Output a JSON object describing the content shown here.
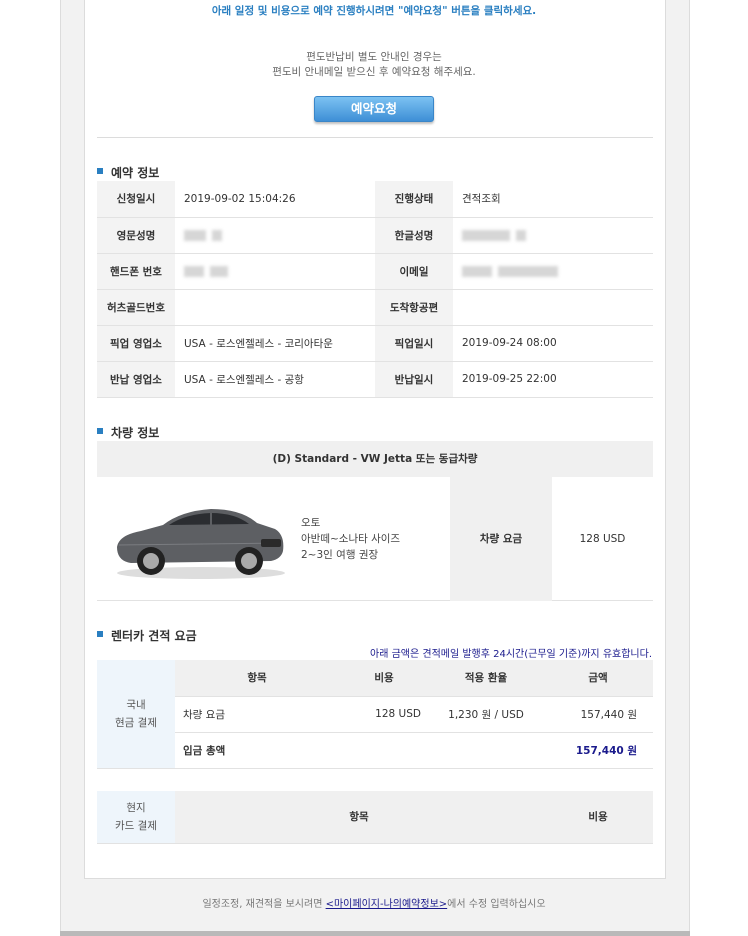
{
  "notice": {
    "top": "아래 일정 및 비용으로 예약 진행하시려면 \"예약요청\" 버튼을 클릭하세요.",
    "sub_line1": "편도반납비 별도 안내인 경우는",
    "sub_line2": "편도비 안내메일 받으신 후 예약요청 해주세요.",
    "reserve_button": "예약요청"
  },
  "reservation": {
    "title": "예약 정보",
    "rows": [
      {
        "l1": "신청일시",
        "v1": "2019-09-02 15:04:26",
        "l2": "진행상태",
        "v2": "견적조회"
      },
      {
        "l1": "영문성명",
        "v1": "",
        "l2": "한글성명",
        "v2": ""
      },
      {
        "l1": "핸드폰 번호",
        "v1": "",
        "l2": "이메일",
        "v2": ""
      },
      {
        "l1": "허츠골드번호",
        "v1": "",
        "l2": "도착항공편",
        "v2": ""
      },
      {
        "l1": "픽업 영업소",
        "v1": "USA - 로스엔젤레스 - 코리아타운",
        "l2": "픽업일시",
        "v2": "2019-09-24 08:00"
      },
      {
        "l1": "반납 영업소",
        "v1": "USA - 로스엔젤레스 - 공항",
        "l2": "반납일시",
        "v2": "2019-09-25 22:00"
      }
    ]
  },
  "vehicle": {
    "title": "차량 정보",
    "name": "(D) Standard - VW Jetta 또는 동급차량",
    "desc1": "오토",
    "desc2": "아반떼~소나타 사이즈",
    "desc3": "2~3인 여행 권장",
    "fee_label": "차량 요금",
    "fee_value": "128 USD"
  },
  "quote": {
    "title": "렌터카 견적 요금",
    "valid_note": "아래 금액은 견적메일 발행후 24시간(근무일 기준)까지 유효합니다.",
    "domestic_label1": "국내",
    "domestic_label2": "현금 결제",
    "headers": [
      "항목",
      "비용",
      "적용 환율",
      "금액"
    ],
    "row": {
      "item": "차량 요금",
      "cost": "128 USD",
      "rate": "1,230 원 / USD",
      "amount": "157,440 원"
    },
    "total_label": "입금 총액",
    "total_amount": "157,440 원",
    "local_label1": "현지",
    "local_label2": "카드 결제",
    "local_headers": [
      "항목",
      "비용"
    ]
  },
  "footer": {
    "before": "일정조정, 재견적을 보시려면 ",
    "link": "<마이페이지-나의예약정보>",
    "after": "에서 수정 입력하십시오"
  },
  "colors": {
    "accent": "#2a7fc1",
    "navy": "#1a1a8c"
  }
}
